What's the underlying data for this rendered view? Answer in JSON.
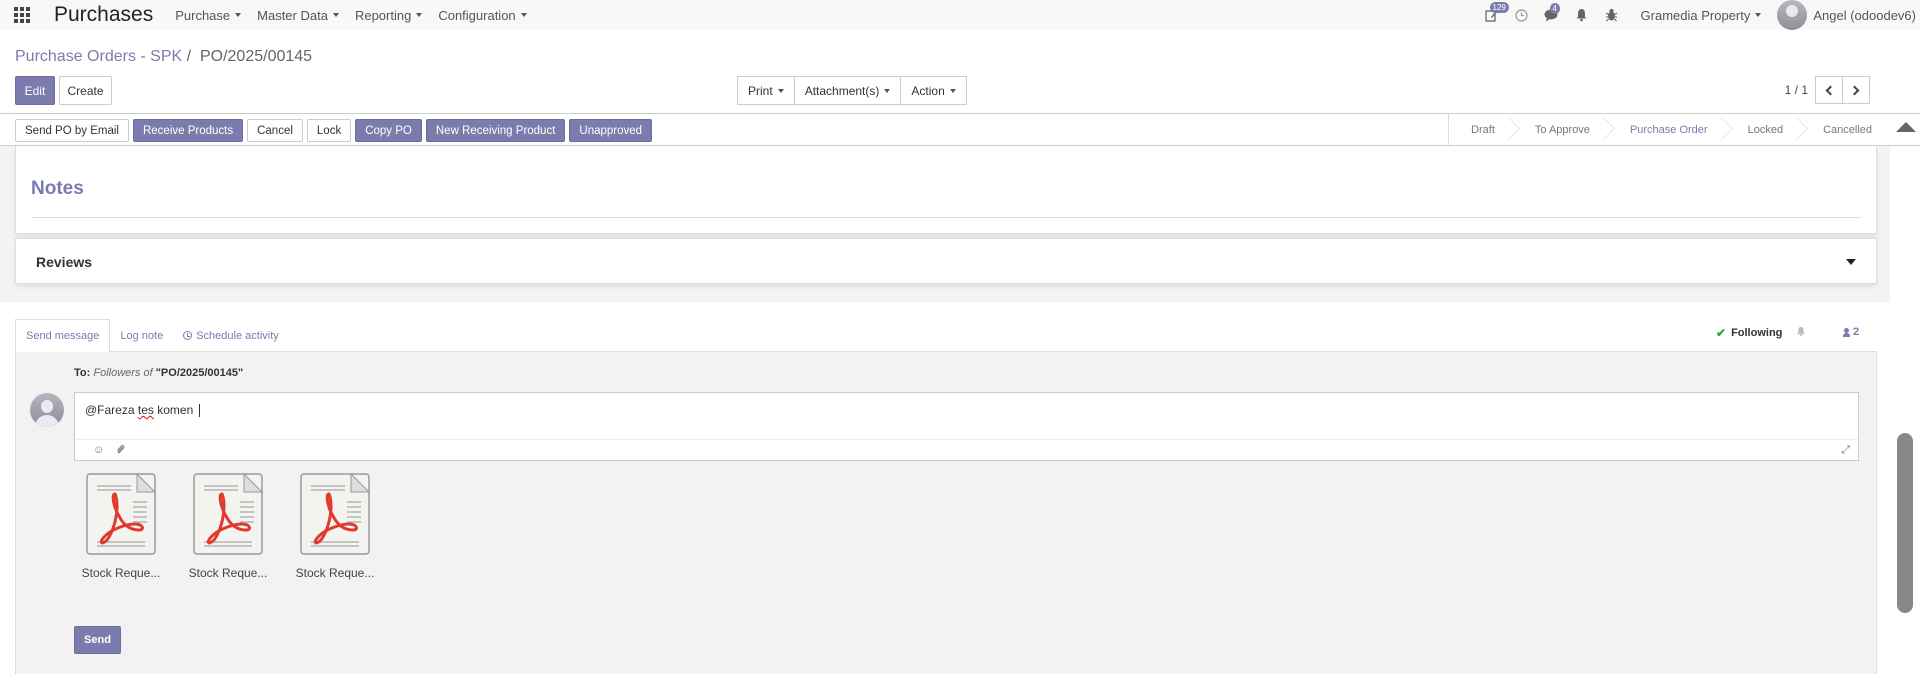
{
  "navbar": {
    "app_name": "Purchases",
    "menus": [
      "Purchase",
      "Master Data",
      "Reporting",
      "Configuration"
    ],
    "badges": {
      "activities": "129",
      "messages": "4"
    },
    "company": "Gramedia Property",
    "user": "Angel (odoodev6)"
  },
  "breadcrumb": {
    "parent": "Purchase Orders - SPK",
    "separator": "/",
    "current": "PO/2025/00145"
  },
  "controls": {
    "edit": "Edit",
    "create": "Create",
    "print": "Print",
    "attachments": "Attachment(s)",
    "action": "Action",
    "pager": "1 / 1"
  },
  "header_buttons": [
    "Send PO by Email",
    "Receive Products",
    "Cancel",
    "Lock",
    "Copy PO",
    "New Receiving Product",
    "Unapproved"
  ],
  "header_buttons_primary": [
    false,
    true,
    false,
    false,
    true,
    true,
    true
  ],
  "stages": {
    "items": [
      "Draft",
      "To Approve",
      "Purchase Order",
      "Locked",
      "Cancelled"
    ],
    "active": "Purchase Order"
  },
  "form": {
    "notes_title": "Notes",
    "reviews_title": "Reviews"
  },
  "chatter": {
    "tabs": [
      "Send message",
      "Log note",
      "Schedule activity"
    ],
    "following": "Following",
    "followers_count": "2",
    "to_label": "To:",
    "to_followers": "Followers of",
    "to_record": "\"PO/2025/00145\"",
    "message": {
      "prefix": "@Fareza ",
      "misspelled": "tes",
      "suffix": " komen"
    },
    "attachments": [
      "Stock Reque...",
      "Stock Reque...",
      "Stock Reque..."
    ],
    "send": "Send"
  },
  "colors": {
    "primary": "#7c7bad",
    "following_check": "#28a745"
  }
}
